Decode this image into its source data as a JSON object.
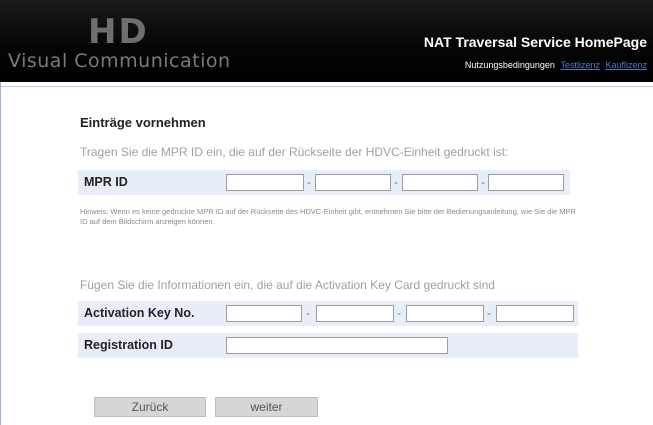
{
  "header": {
    "logo_mark": "HD",
    "logo_text": "Visual Communication",
    "title": "NAT Traversal Service HomePage",
    "links": {
      "terms": "Nutzungsbedingungen",
      "link1": "Testlizenz",
      "link2": "Kauflizenz"
    }
  },
  "mpr_section": {
    "title": "Einträge vornehmen",
    "instruction": "Tragen Sie die MPR ID ein, die auf der Rückseite der HDVC-Einheit gedruckt ist:",
    "label": "MPR ID",
    "separator": "-",
    "note": "Hinweis: Wenn es keine gedruckte MPR ID auf der Rückseite des HDVC-Einheit gibt, entnehmen Sie bitte der Bedienungsanleitung, wie Sie die MPR ID auf dem Bildschirm anzeigen können."
  },
  "activation_section": {
    "instruction": "Fügen Sie die Informationen ein, die auf die Activation Key Card gedruckt sind",
    "key_label": "Activation Key No.",
    "registration_label": "Registration ID",
    "separator": "-"
  },
  "buttons": {
    "back": "Zurück",
    "next": "weiter"
  }
}
